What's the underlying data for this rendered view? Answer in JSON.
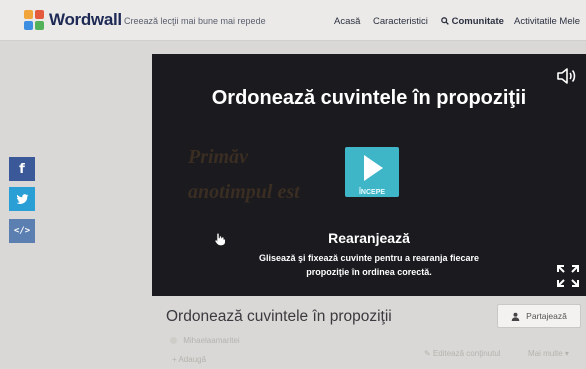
{
  "header": {
    "logo_text": "Wordwall",
    "tagline": "Creează lecţii mai bune mai repede",
    "nav": [
      {
        "label": "Acasă",
        "icon": ""
      },
      {
        "label": "Caracteristici",
        "icon": ""
      },
      {
        "label": "Comunitate",
        "icon": "search-icon"
      },
      {
        "label": "Activitatile Mele",
        "icon": ""
      }
    ]
  },
  "share_rail": [
    {
      "name": "facebook",
      "glyph": "f",
      "color": "#3b5998"
    },
    {
      "name": "twitter",
      "glyph": "🐦",
      "color": "#2a9fd6"
    },
    {
      "name": "embed",
      "glyph": "</>",
      "color": "#5a7fb0"
    }
  ],
  "player": {
    "title": "Ordonează cuvintele în propoziţii",
    "background_text": [
      "Primăv",
      "anotimpul  est"
    ],
    "start_label": "ÎNCEPE",
    "template_name": "Rearanjează",
    "template_description": "Glisează şi fixează cuvinte pentru a rearanja fiecare propoziţie în ordinea corectă."
  },
  "activity": {
    "title": "Ordonează cuvintele în propoziţii",
    "author": "Mihaelaamaritei",
    "share_label": "Partajează",
    "add_label": "Adaugă",
    "edit_label": "Editează conţinutul",
    "more_label": "Mai multe"
  },
  "colors": {
    "accent": "#3fb6c8",
    "player_bg": "#1a1a1f",
    "brand": "#1e2a55"
  }
}
